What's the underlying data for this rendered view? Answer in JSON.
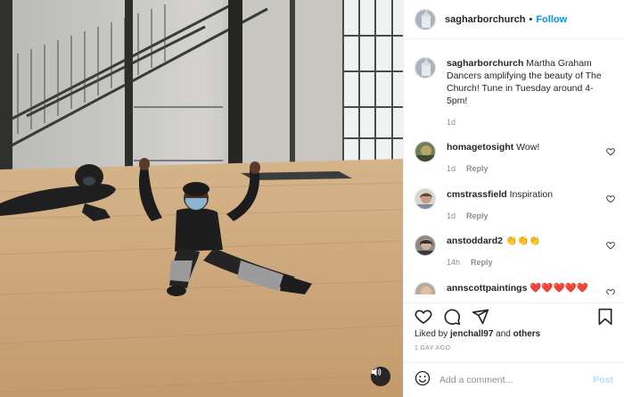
{
  "post": {
    "author": "sagharborchurch",
    "separator": "•",
    "follow_label": "Follow"
  },
  "caption": {
    "author": "sagharborchurch",
    "text": "Martha Graham Dancers amplifying the beauty of The Church! Tune in Tuesday around 4-5pm!",
    "time": "1d"
  },
  "comments": [
    {
      "user": "homagetosight",
      "text": "Wow!",
      "time": "1d",
      "reply_label": "Reply"
    },
    {
      "user": "cmstrassfield",
      "text": "Inspiration",
      "time": "1d",
      "reply_label": "Reply"
    },
    {
      "user": "anstoddard2",
      "text": "👏👏👏",
      "time": "14h",
      "reply_label": "Reply"
    },
    {
      "user": "annscottpaintings",
      "text": "❤️❤️❤️❤️❤️",
      "time": "",
      "reply_label": ""
    }
  ],
  "likes": {
    "prefix": "Liked by",
    "user": "jenchall97",
    "joiner": "and",
    "others": "others"
  },
  "time_ago": "1 DAY AGO",
  "add_comment": {
    "placeholder": "Add a comment...",
    "post_label": "Post"
  },
  "colors": {
    "accent": "#0095f6",
    "post_disabled": "#b2dffc",
    "muted": "#8e8e8e",
    "floor": "#c9a277"
  }
}
